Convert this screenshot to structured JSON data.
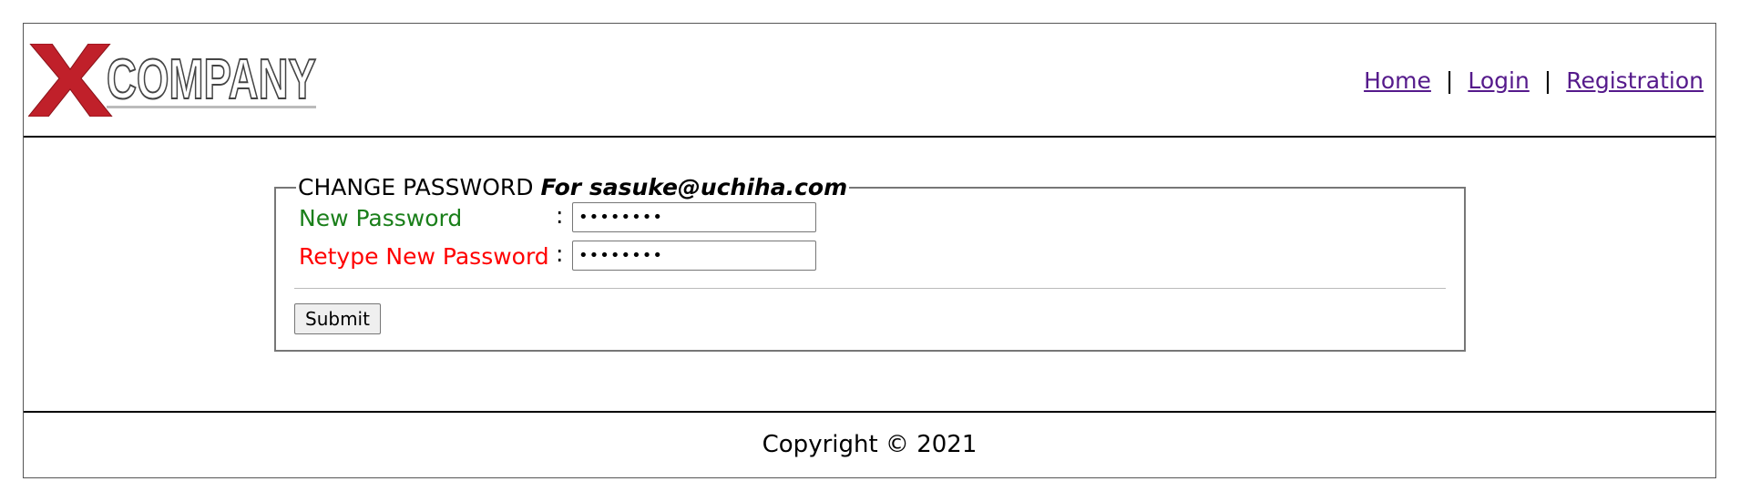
{
  "header": {
    "logo_text": "COMPANY",
    "logo_mark": "X",
    "nav": {
      "home": "Home",
      "login": "Login",
      "registration": "Registration",
      "separator": "|"
    }
  },
  "form": {
    "legend_title": "CHANGE PASSWORD",
    "legend_for": "For sasuke@uchiha.com",
    "new_password_label": "New Password",
    "retype_password_label": "Retype New Password",
    "colon": ":",
    "new_password_value": "••••••••",
    "retype_password_value": "••••••••",
    "submit_label": "Submit"
  },
  "footer": {
    "copyright": "Copyright © 2021"
  },
  "colors": {
    "logo_red": "#c0202a",
    "label_green": "#1a7f1a",
    "label_red": "#ff0000",
    "link": "#551a8b"
  }
}
